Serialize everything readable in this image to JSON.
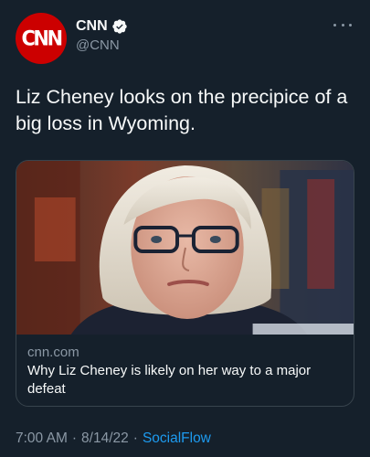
{
  "account": {
    "display_name": "CNN",
    "handle": "@CNN",
    "avatar_text": "CNN",
    "verified": true
  },
  "tweet": {
    "text": "Liz Cheney looks on the precipice of a big loss in Wyoming."
  },
  "card": {
    "domain": "cnn.com",
    "title": "Why Liz Cheney is likely on her way to a major defeat",
    "image_description_icon": "photo"
  },
  "meta": {
    "time": "7:00 AM",
    "date": "8/14/22",
    "separator": "·",
    "source": "SocialFlow"
  },
  "colors": {
    "background": "#15202b",
    "text_primary": "#f7f9f9",
    "text_secondary": "#8b98a5",
    "link": "#1d9bf0",
    "verified": "#f7f9f9",
    "avatar_bg": "#cc0000"
  },
  "icons": {
    "verified": "verified-badge-icon",
    "more": "more-horizontal-icon"
  }
}
